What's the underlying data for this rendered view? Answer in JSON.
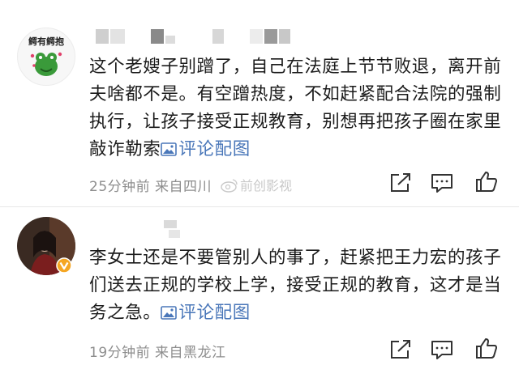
{
  "comments": [
    {
      "avatar_text": "鳄有鳄抱",
      "text": "这个老嫂子别蹭了，自己在法庭上节节败退，离开前夫啥都不是。有空蹭热度，不如赶紧配合法院的强制执行，让孩子接受正规教育，别想再把孩子圈在家里敲诈勒索",
      "pic_link": "评论配图",
      "time": "25分钟前",
      "location": "来自四川"
    },
    {
      "text": "李女士还是不要管别人的事了，赶紧把王力宏的孩子们送去正规的学校上学，接受正规的教育，这才是当务之急。",
      "pic_link": "评论配图",
      "time": "19分钟前",
      "location": "来自黑龙江"
    }
  ],
  "watermark": "前创影视",
  "colors": {
    "link": "#4a77b9",
    "meta": "#8e8e8e",
    "verified": "#f5a623"
  },
  "icons": [
    "share-icon",
    "comment-icon",
    "like-icon",
    "image-icon",
    "verified-badge-icon"
  ]
}
